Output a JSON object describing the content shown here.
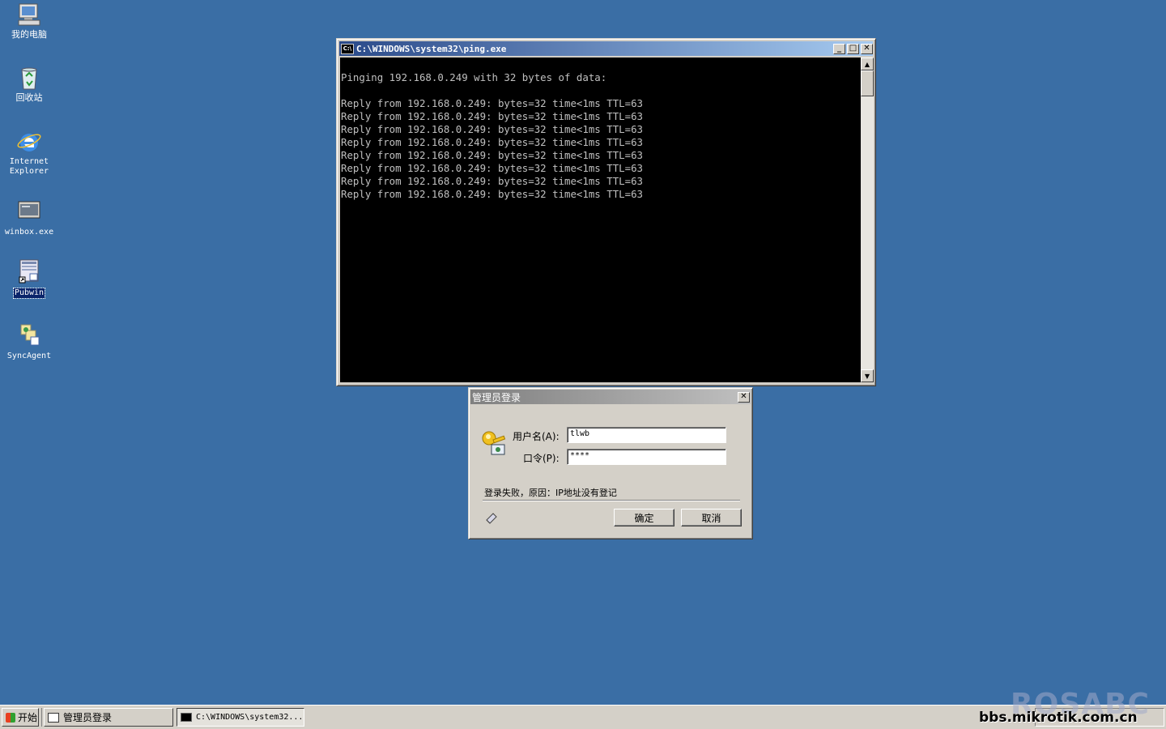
{
  "desktop": {
    "icons": [
      {
        "label": "我的电脑"
      },
      {
        "label": "回收站"
      },
      {
        "label": "Internet\nExplorer"
      },
      {
        "label": "winbox.exe"
      },
      {
        "label": "Pubwin"
      },
      {
        "label": "SyncAgent"
      }
    ]
  },
  "console_window": {
    "title": "C:\\WINDOWS\\system32\\ping.exe",
    "lines": [
      "Pinging 192.168.0.249 with 32 bytes of data:",
      "",
      "Reply from 192.168.0.249: bytes=32 time<1ms TTL=63",
      "Reply from 192.168.0.249: bytes=32 time<1ms TTL=63",
      "Reply from 192.168.0.249: bytes=32 time<1ms TTL=63",
      "Reply from 192.168.0.249: bytes=32 time<1ms TTL=63",
      "Reply from 192.168.0.249: bytes=32 time<1ms TTL=63",
      "Reply from 192.168.0.249: bytes=32 time<1ms TTL=63",
      "Reply from 192.168.0.249: bytes=32 time<1ms TTL=63",
      "Reply from 192.168.0.249: bytes=32 time<1ms TTL=63"
    ]
  },
  "login_dialog": {
    "title": "管理员登录",
    "username_label": "用户名(A):",
    "username_value": "tlwb",
    "password_label": "口令(P):",
    "password_value": "****",
    "status_message": "登录失败，原因：IP地址没有登记",
    "ok_label": "确定",
    "cancel_label": "取消"
  },
  "taskbar": {
    "start_label": "开始",
    "tasks": [
      {
        "label": "管理员登录"
      },
      {
        "label": "C:\\WINDOWS\\system32..."
      }
    ]
  },
  "watermark": {
    "text": "bbs.mikrotik.com.cn",
    "logo_text": "ROSABC"
  },
  "colors": {
    "desktop_bg": "#3a6ea5",
    "active_title_start": "#0a246a",
    "active_title_end": "#a6caf0",
    "inactive_title": "#808080",
    "console_bg": "#000000",
    "console_fg": "#c0c0c0"
  }
}
